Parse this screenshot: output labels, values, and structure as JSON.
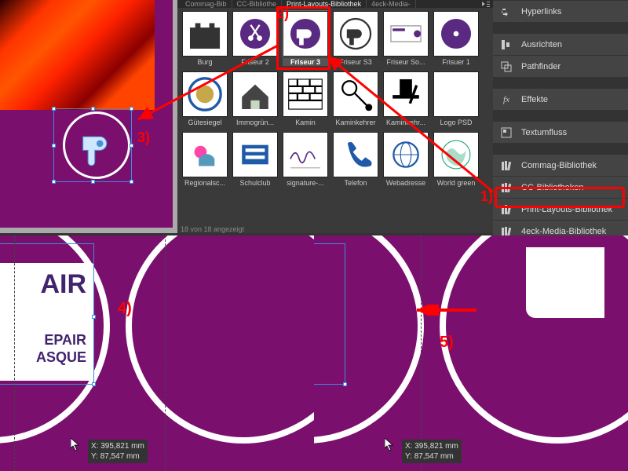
{
  "library": {
    "tabs": [
      "Commag-Bib",
      "CC-Bibliothe",
      "Print-Layouts-Bibliothek",
      "4eck-Media-"
    ],
    "active_tab": 2,
    "status": "18 von 18 angezeigt",
    "items": [
      {
        "label": "Burg",
        "icon": "castle"
      },
      {
        "label": "Friseur 2",
        "icon": "circle-scissors"
      },
      {
        "label": "Friseur 3",
        "icon": "circle-dryer"
      },
      {
        "label": "Friseur S3",
        "icon": "dryer-outline"
      },
      {
        "label": "Friseur So...",
        "icon": "biz-card"
      },
      {
        "label": "Frisuer 1",
        "icon": "circle-dot"
      },
      {
        "label": "Gütesiegel",
        "icon": "seal"
      },
      {
        "label": "Immogrün...",
        "icon": "house"
      },
      {
        "label": "Kamin",
        "icon": "bricks"
      },
      {
        "label": "Kaminkehrer",
        "icon": "sweep"
      },
      {
        "label": "Kaminkehr...",
        "icon": "tophat"
      },
      {
        "label": "Logo PSD",
        "icon": "blank"
      },
      {
        "label": "Regionalsc...",
        "icon": "school-a"
      },
      {
        "label": "Schulclub",
        "icon": "school-b"
      },
      {
        "label": "signature-...",
        "icon": "sig"
      },
      {
        "label": "Telefon",
        "icon": "phone"
      },
      {
        "label": "Webadresse",
        "icon": "web"
      },
      {
        "label": "World green",
        "icon": "globe"
      }
    ]
  },
  "side_items": [
    {
      "label": "Hyperlinks",
      "icon": "link"
    },
    {
      "label": "Ausrichten",
      "icon": "align"
    },
    {
      "label": "Pathfinder",
      "icon": "pathfinder"
    },
    {
      "label": "Effekte",
      "icon": "fx"
    },
    {
      "label": "Textumfluss",
      "icon": "textwrap"
    },
    {
      "label": "Commag-Bibliothek",
      "icon": "books"
    },
    {
      "label": "CC-Bibliotheken",
      "icon": "books"
    },
    {
      "label": "Print-Layouts-Bibliothek",
      "icon": "books"
    },
    {
      "label": "4eck-Media-Bibliothek",
      "icon": "books"
    }
  ],
  "annotations": {
    "a1": "1)",
    "a2": "2)",
    "a3": "3)",
    "a4": "4)",
    "a5": "5)"
  },
  "bottle": {
    "line1": "AIR",
    "line2": "EPAIR",
    "line3": "ASQUE"
  },
  "coords": {
    "x_label": "X:",
    "y_label": "Y:",
    "x_val": "395,821 mm",
    "y_val": "87,547 mm"
  },
  "colors": {
    "accent_red": "#ff0000",
    "canvas": "#7a0f6e",
    "panel": "#3a3a3a",
    "side": "#444444"
  }
}
